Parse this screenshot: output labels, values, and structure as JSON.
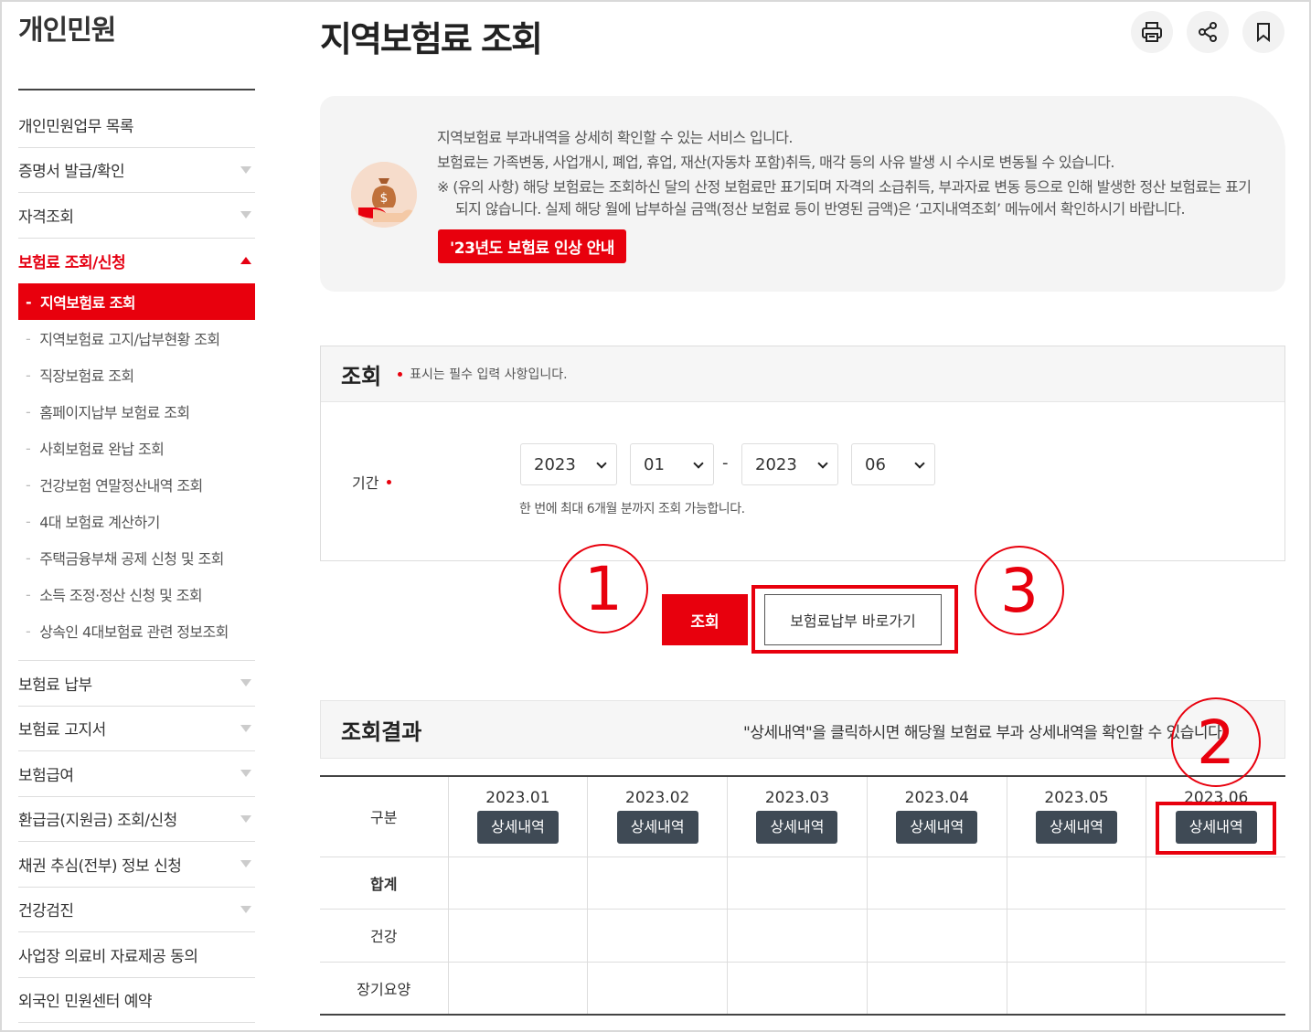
{
  "sidebar": {
    "title": "개인민원",
    "items": [
      {
        "label": "개인민원업무 목록",
        "arrow": false
      },
      {
        "label": "증명서 발급/확인",
        "arrow": true
      },
      {
        "label": "자격조회",
        "arrow": true
      },
      {
        "label": "보험료 조회/신청",
        "arrow": true,
        "active": true
      }
    ],
    "subitems": [
      "지역보험료 조회",
      "지역보험료 고지/납부현황 조회",
      "직장보험료 조회",
      "홈페이지납부 보험료 조회",
      "사회보험료 완납 조회",
      "건강보험 연말정산내역 조회",
      "4대 보험료 계산하기",
      "주택금융부채 공제 신청 및 조회",
      "소득 조정·정산 신청 및 조회",
      "상속인 4대보험료 관련 정보조회"
    ],
    "items_after": [
      "보험료 납부",
      "보험료 고지서",
      "보험급여",
      "환급금(지원금) 조회/신청",
      "채권 추심(전부) 정보 신청",
      "건강검진",
      "사업장 의료비 자료제공 동의",
      "외국인 민원센터 예약"
    ]
  },
  "header": {
    "title": "지역보험료 조회"
  },
  "info": {
    "line1": "지역보험료 부과내역을 상세히 확인할 수 있는 서비스 입니다.",
    "line2": "보험료는 가족변동, 사업개시, 폐업, 휴업, 재산(자동차 포함)취득, 매각 등의 사유 발생 시 수시로 변동될 수 있습니다.",
    "note": "※ (유의 사항) 해당 보험료는 조회하신 달의 산정 보험료만 표기되며 자격의 소급취득, 부과자료 변동 등으로 인해 발생한 정산 보험료는 표기되지 않습니다. 실제 해당 월에 납부하실 금액(정산 보험료 등이 반영된 금액)은 ‘고지내역조회’ 메뉴에서 확인하시기 바랍니다.",
    "notice_button": "'23년도 보험료 인상 안내"
  },
  "search": {
    "title": "조회",
    "required_note": "표시는 필수 입력 사항입니다.",
    "period_label": "기간",
    "start_year": "2023",
    "start_month": "01",
    "separator": "-",
    "end_year": "2023",
    "end_month": "06",
    "limit_note": "한 번에 최대 6개월 분까지 조회 가능합니다.",
    "search_button": "조회",
    "pay_button": "보험료납부 바로가기"
  },
  "annotations": {
    "one": "1",
    "two": "2",
    "three": "3"
  },
  "result": {
    "title": "조회결과",
    "hint": "\"상세내역\"을 클릭하시면 해당월 보험료 부과 상세내역을 확인할 수 있습니다.",
    "header_label": "구분",
    "detail_label": "상세내역",
    "months": [
      "2023.01",
      "2023.02",
      "2023.03",
      "2023.04",
      "2023.05",
      "2023.06"
    ],
    "rows": [
      "합계",
      "건강",
      "장기요양"
    ]
  }
}
